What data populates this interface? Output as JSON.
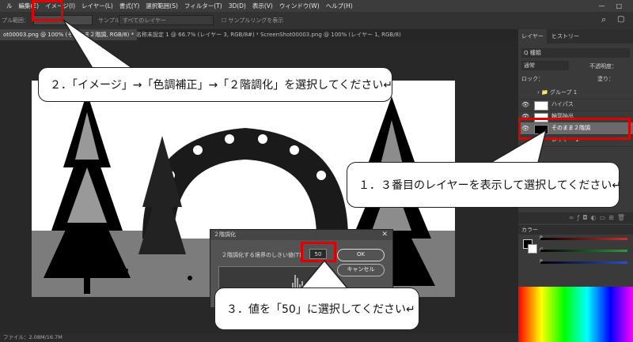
{
  "menubar": {
    "items": [
      "ル",
      "編集(E)",
      "イメージ(I)",
      "レイヤー(L)",
      "書式(Y)",
      "選択範囲(S)",
      "フィルター(T)",
      "3D(D)",
      "表示(V)",
      "ウィンドウ(W)",
      "ヘルプ(H)"
    ]
  },
  "optionsbar": {
    "sample_range_label": "プル範囲：",
    "sample_label": "サンプル：",
    "sample_value": "すべてのレイヤー",
    "show_ring_label": "サンプルリングを表示"
  },
  "tabs": [
    {
      "label": "ot00003.png @ 100% (そのまま２階調, RGB/8) *",
      "active": true
    },
    {
      "label": "名称未設定 1 @ 66.7% (レイヤー 3, RGB/8#) *",
      "active": false
    },
    {
      "label": "ScreenShot00003.png @ 100% (レイヤー 1, RGB/8)",
      "active": false
    }
  ],
  "status": {
    "text": "ファイル：2.08M/16.7M"
  },
  "layers_panel": {
    "tab_layers": "レイヤー",
    "tab_history": "ヒストリー",
    "search_label": "Q 種類",
    "blend_mode": "通常",
    "opacity_label": "不透明度：",
    "lock_label": "ロック：",
    "fill_label": "塗り：",
    "layers": [
      {
        "name": "グループ 1",
        "visible": false,
        "selected": false
      },
      {
        "name": "ハイパス",
        "visible": true,
        "selected": false
      },
      {
        "name": "輪郭抽出",
        "visible": true,
        "selected": false
      },
      {
        "name": "そのまま２階調",
        "visible": true,
        "selected": true
      },
      {
        "name": "レイヤー 1",
        "visible": false,
        "selected": false
      }
    ]
  },
  "color_panel": {
    "title": "カラー",
    "channels": [
      "R",
      "G",
      "B"
    ]
  },
  "dialog": {
    "title": "２階調化",
    "threshold_label": "２階調化する境界のしきい値(T):",
    "threshold_value": "50",
    "ok_label": "OK",
    "cancel_label": "キャンセル"
  },
  "callouts": {
    "step1": "１．３番目のレイヤーを表示して選択してください↵",
    "step2": "２．「イメージ」→「色調補正」→「２階調化」を選択してください↵",
    "step3": "３．値を「50」に選択してください↵"
  },
  "colors": {
    "highlight": "#e00000",
    "selected_layer": "#6a6a6a",
    "slider_r": "#c8302c",
    "slider_g": "#2c9a3c",
    "slider_b": "#2c4fc8"
  }
}
